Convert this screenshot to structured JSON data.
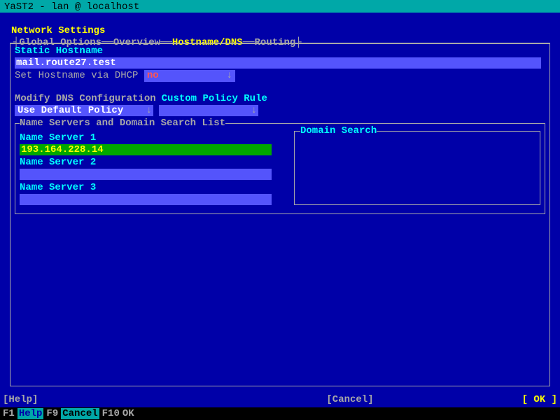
{
  "titlebar": "YaST2 - lan @ localhost",
  "page_title": "Network Settings",
  "tabs": {
    "global": "Global Options",
    "overview": "Overview",
    "hostname": "Hostname/DNS",
    "routing": "Routing"
  },
  "static_hostname_label": "Static Hostname",
  "static_hostname_value": "mail.route27.test",
  "set_hostname_dhcp_label": "Set Hostname via DHCP",
  "set_hostname_dhcp_value": "no",
  "modify_dns_label": "Modify DNS Configuration",
  "custom_policy_label": "Custom Policy Rule",
  "modify_dns_value": "Use Default Policy",
  "custom_policy_value": "",
  "ns_fieldset_legend": "Name Servers and Domain Search List",
  "ns1_label": "Name Server 1",
  "ns1_value": "193.164.228.14",
  "ns2_label": "Name Server 2",
  "ns2_value": "",
  "ns3_label": "Name Server 3",
  "ns3_value": "",
  "domain_search_legend": "Domain Search",
  "domain_search_value": "",
  "btn_help": "[Help]",
  "btn_cancel": "[Cancel]",
  "btn_ok": "[ OK ]",
  "fkeys": {
    "f1": "Help",
    "f9": "Cancel",
    "f10": "OK"
  },
  "arrow_down": "↓"
}
